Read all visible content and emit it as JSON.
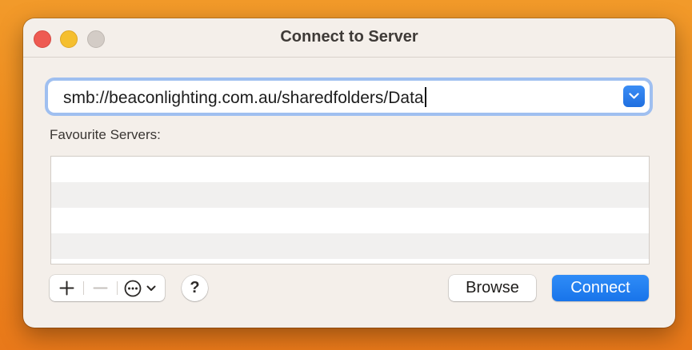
{
  "window": {
    "title": "Connect to Server"
  },
  "server_address": {
    "value": "smb://beaconlighting.com.au/sharedfolders/Data"
  },
  "favourites": {
    "label": "Favourite Servers:",
    "items": []
  },
  "toolbar": {
    "add_icon": "plus-icon",
    "remove_icon": "minus-icon",
    "more_icon": "ellipsis-circle-icon",
    "help_label": "?",
    "browse_label": "Browse",
    "connect_label": "Connect"
  },
  "colors": {
    "accent": "#1f78ec",
    "close": "#ee5a52",
    "minimize": "#f5bf2f",
    "zoom_inactive": "#d3ccc6"
  }
}
